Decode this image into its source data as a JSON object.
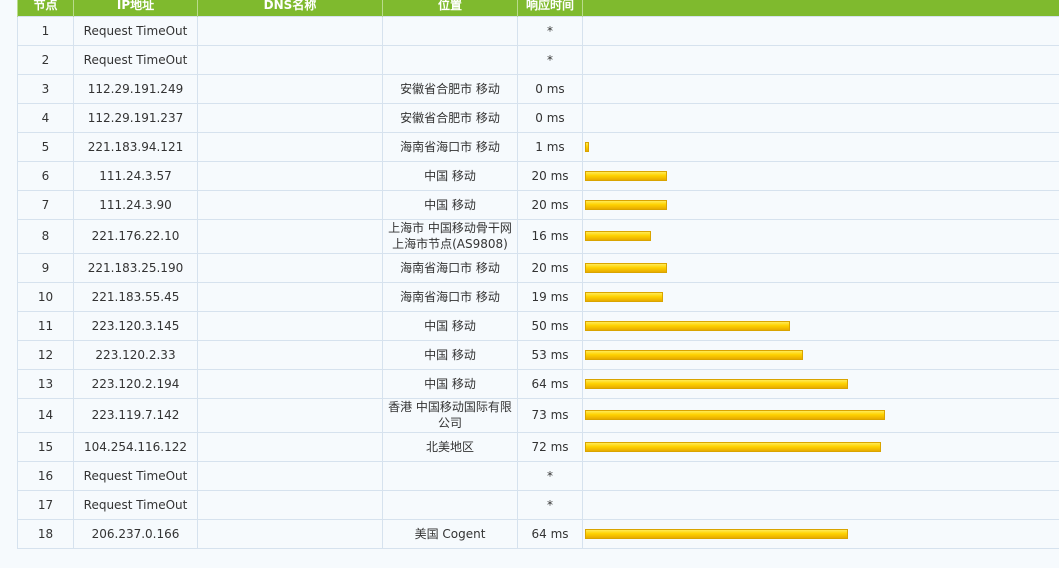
{
  "table": {
    "headers": [
      "节点",
      "IP地址",
      "DNS名称",
      "位置",
      "响应时间"
    ],
    "max_rt_ms": 73,
    "rows": [
      {
        "hop": "1",
        "ip": "Request TimeOut",
        "dns": "",
        "location": "",
        "rt": "*",
        "rt_ms": null
      },
      {
        "hop": "2",
        "ip": "Request TimeOut",
        "dns": "",
        "location": "",
        "rt": "*",
        "rt_ms": null
      },
      {
        "hop": "3",
        "ip": "112.29.191.249",
        "dns": "",
        "location": "安徽省合肥市 移动",
        "rt": "0 ms",
        "rt_ms": 0
      },
      {
        "hop": "4",
        "ip": "112.29.191.237",
        "dns": "",
        "location": "安徽省合肥市 移动",
        "rt": "0 ms",
        "rt_ms": 0
      },
      {
        "hop": "5",
        "ip": "221.183.94.121",
        "dns": "",
        "location": "海南省海口市 移动",
        "rt": "1 ms",
        "rt_ms": 1
      },
      {
        "hop": "6",
        "ip": "111.24.3.57",
        "dns": "",
        "location": "中国 移动",
        "rt": "20 ms",
        "rt_ms": 20
      },
      {
        "hop": "7",
        "ip": "111.24.3.90",
        "dns": "",
        "location": "中国 移动",
        "rt": "20 ms",
        "rt_ms": 20
      },
      {
        "hop": "8",
        "ip": "221.176.22.10",
        "dns": "",
        "location": "上海市 中国移动骨干网上海市节点(AS9808)",
        "rt": "16 ms",
        "rt_ms": 16,
        "tall": true
      },
      {
        "hop": "9",
        "ip": "221.183.25.190",
        "dns": "",
        "location": "海南省海口市 移动",
        "rt": "20 ms",
        "rt_ms": 20
      },
      {
        "hop": "10",
        "ip": "221.183.55.45",
        "dns": "",
        "location": "海南省海口市 移动",
        "rt": "19 ms",
        "rt_ms": 19
      },
      {
        "hop": "11",
        "ip": "223.120.3.145",
        "dns": "",
        "location": "中国 移动",
        "rt": "50 ms",
        "rt_ms": 50
      },
      {
        "hop": "12",
        "ip": "223.120.2.33",
        "dns": "",
        "location": "中国 移动",
        "rt": "53 ms",
        "rt_ms": 53
      },
      {
        "hop": "13",
        "ip": "223.120.2.194",
        "dns": "",
        "location": "中国 移动",
        "rt": "64 ms",
        "rt_ms": 64
      },
      {
        "hop": "14",
        "ip": "223.119.7.142",
        "dns": "",
        "location": "香港 中国移动国际有限公司",
        "rt": "73 ms",
        "rt_ms": 73,
        "tall": true
      },
      {
        "hop": "15",
        "ip": "104.254.116.122",
        "dns": "",
        "location": "北美地区",
        "rt": "72 ms",
        "rt_ms": 72
      },
      {
        "hop": "16",
        "ip": "Request TimeOut",
        "dns": "",
        "location": "",
        "rt": "*",
        "rt_ms": null
      },
      {
        "hop": "17",
        "ip": "Request TimeOut",
        "dns": "",
        "location": "",
        "rt": "*",
        "rt_ms": null
      },
      {
        "hop": "18",
        "ip": "206.237.0.166",
        "dns": "",
        "location": "美国 Cogent",
        "rt": "64 ms",
        "rt_ms": 64
      }
    ]
  },
  "colors": {
    "header_bg": "#7fba2e",
    "bar_fill": "#ffd200",
    "row_bg": "#f6fafd",
    "grid": "#d6e2ee"
  }
}
